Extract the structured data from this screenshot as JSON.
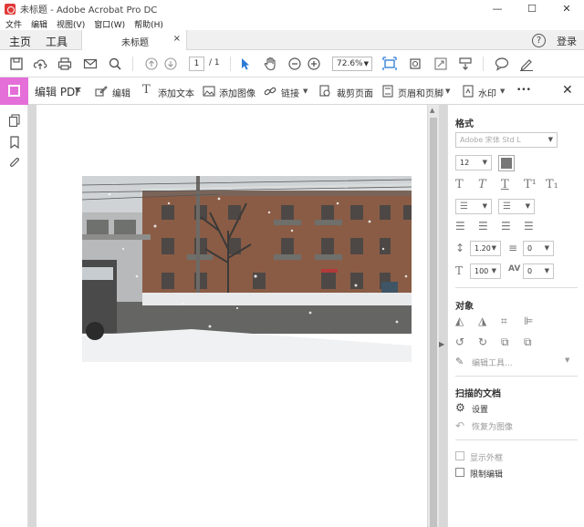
{
  "window": {
    "title": "未标题 - Adobe Acrobat Pro DC",
    "min": "—",
    "max": "☐",
    "close": "✕"
  },
  "menu": [
    "文件",
    "编辑",
    "视图(V)",
    "窗口(W)",
    "帮助(H)"
  ],
  "tabs": {
    "home": "主页",
    "tools": "工具",
    "document": "未标题",
    "close": "×"
  },
  "header": {
    "help": "?",
    "login": "登录"
  },
  "toolbar": {
    "page_current": "1",
    "page_total": "/ 1",
    "zoom": "72.6%"
  },
  "edit_tools": {
    "title": "编辑 PDF",
    "edit": "编辑",
    "add_text": "添加文本",
    "add_image": "添加图像",
    "link": "链接",
    "crop": "裁剪页面",
    "header_footer": "页眉和页脚",
    "watermark": "水印",
    "more": "•••",
    "close": "✕"
  },
  "format_panel": {
    "heading": "格式",
    "font": "Adobe 宋体 Std L",
    "size": "12",
    "line_spacing": "1.20",
    "para_spacing": "0",
    "scale": "100",
    "char_spacing": "0"
  },
  "objects_panel": {
    "heading": "对象",
    "edit_tools": "编辑工具..."
  },
  "scanned_panel": {
    "heading": "扫描的文档",
    "settings": "设置",
    "revert": "恢复为图像"
  },
  "options": {
    "show_outline": "显示外框",
    "restrict_edit": "限制编辑"
  },
  "colors": {
    "accent_pink": "#e46fd8",
    "selected_blue": "#2a7ad5"
  }
}
